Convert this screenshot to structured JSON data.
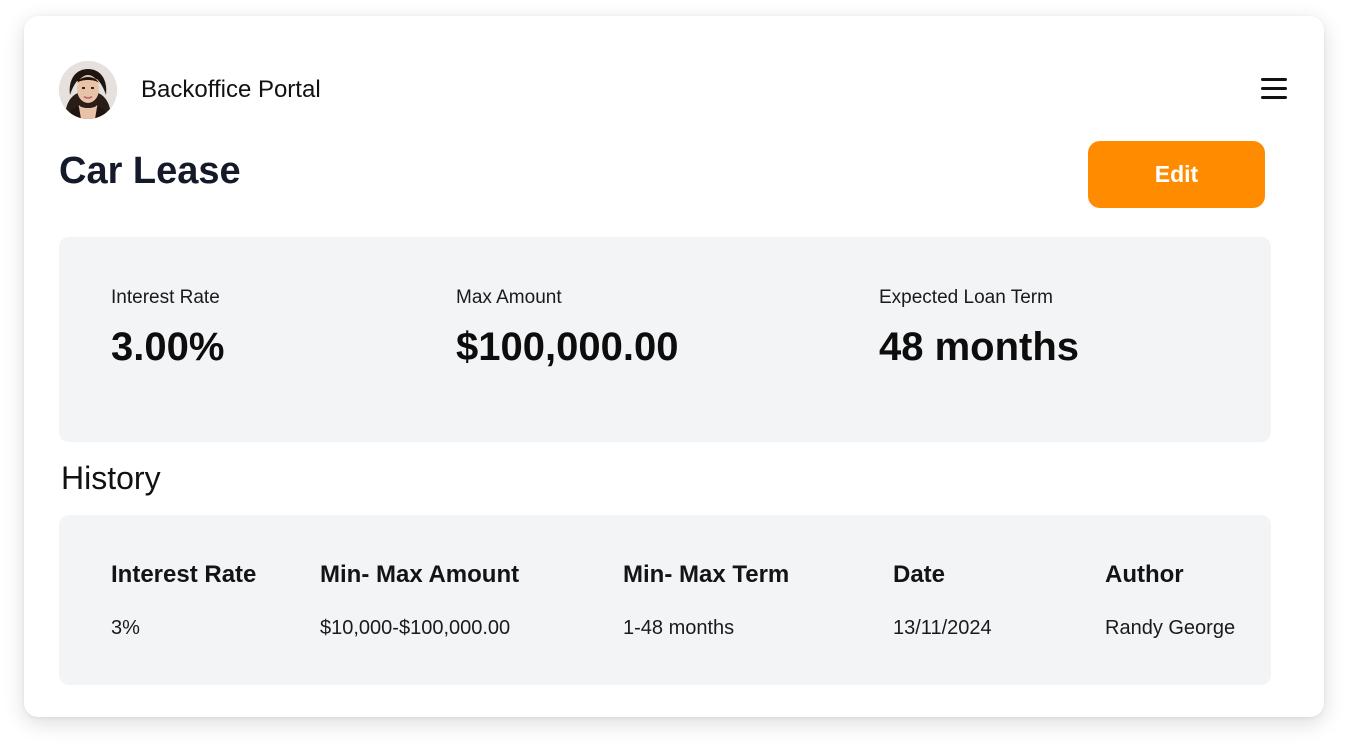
{
  "header": {
    "portal_title": "Backoffice Portal",
    "menu_icon": "hamburger-menu-icon"
  },
  "page": {
    "title": "Car Lease",
    "edit_label": "Edit"
  },
  "colors": {
    "accent": "#ff8c00",
    "panel_bg": "#f3f4f6",
    "title_text": "#151a2b"
  },
  "summary": {
    "interest_rate": {
      "label": "Interest Rate",
      "value": "3.00%"
    },
    "max_amount": {
      "label": "Max Amount",
      "value": "$100,000.00"
    },
    "loan_term": {
      "label": "Expected Loan Term",
      "value": "48 months"
    }
  },
  "history": {
    "title": "History",
    "columns": [
      "Interest Rate",
      "Min- Max Amount",
      "Min- Max Term",
      "Date",
      "Author"
    ],
    "rows": [
      [
        "3%",
        "$10,000-$100,000.00",
        "1-48 months",
        "13/11/2024",
        "Randy George"
      ]
    ]
  }
}
